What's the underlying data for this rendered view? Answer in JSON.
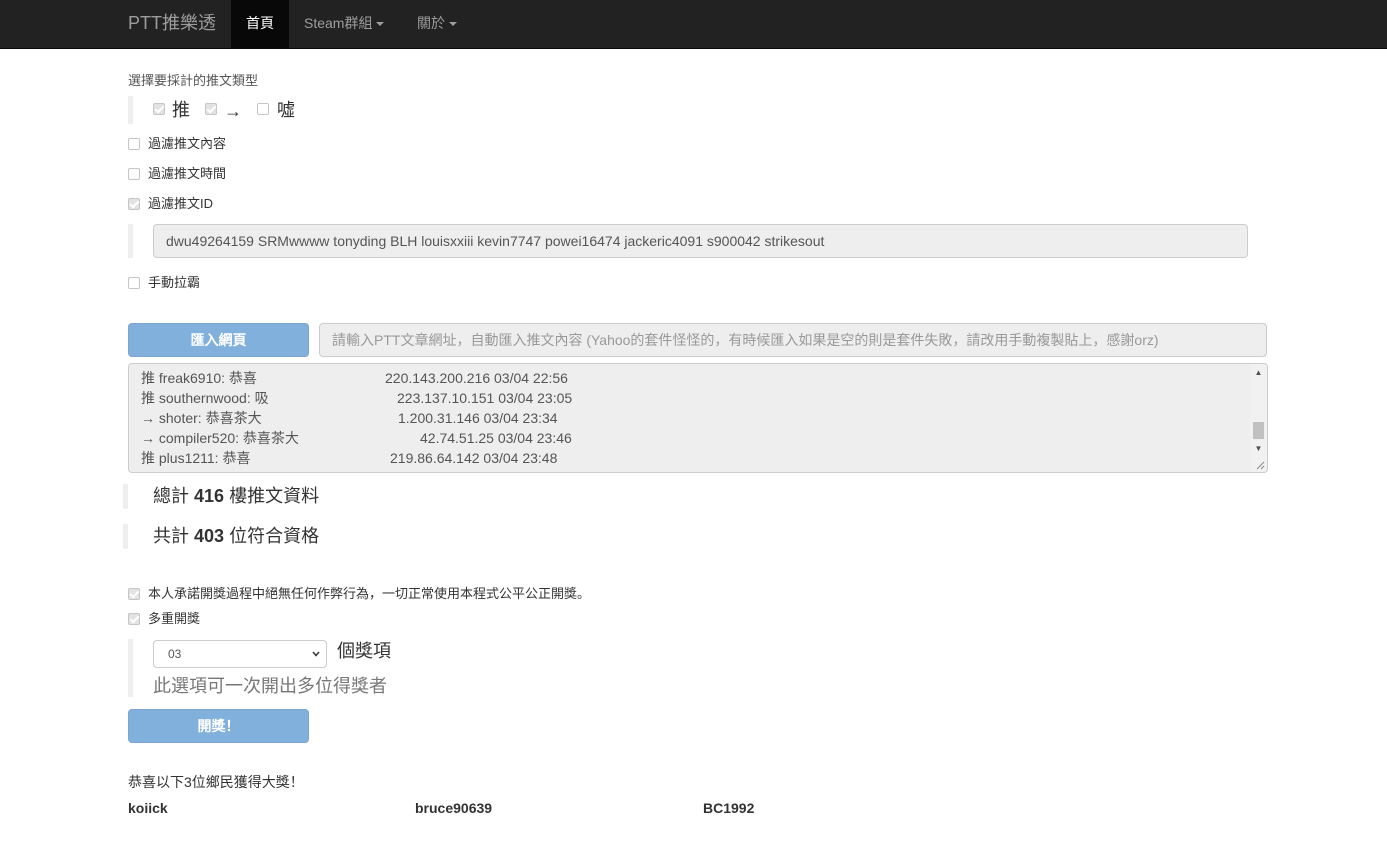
{
  "navbar": {
    "brand": "PTT推樂透",
    "items": [
      {
        "label": "首頁",
        "active": true
      },
      {
        "label": "Steam群組",
        "dropdown": true
      },
      {
        "label": "關於",
        "dropdown": true
      }
    ]
  },
  "push_type": {
    "heading": "選擇要採計的推文類型",
    "options": [
      {
        "label": "推",
        "checked": true
      },
      {
        "label": "→",
        "checked": true
      },
      {
        "label": "噓",
        "checked": false
      }
    ]
  },
  "filters": {
    "content": {
      "label": "過濾推文內容",
      "checked": false
    },
    "time": {
      "label": "過濾推文時間",
      "checked": false
    },
    "id": {
      "label": "過濾推文ID",
      "checked": true
    },
    "id_list": "dwu49264159 SRMwwww tonyding BLH louisxxiii kevin7747 powei16474 jackeric4091 s900042 strikesout",
    "manual": {
      "label": "手動拉霸",
      "checked": false
    }
  },
  "import": {
    "button_label": "匯入網頁",
    "url_placeholder": "請輸入PTT文章網址，自動匯入推文內容 (Yahoo的套件怪怪的，有時候匯入如果是空的則是套件失敗，請改用手動複製貼上，感謝orz)"
  },
  "push_list": [
    {
      "text": "推 freak6910: 恭喜",
      "meta": "220.143.200.216 03/04 22:56"
    },
    {
      "text": "推 southernwood: 吸",
      "meta": "223.137.10.151 03/04 23:05"
    },
    {
      "text": "→ shoter: 恭喜茶大",
      "meta": "1.200.31.146 03/04 23:34"
    },
    {
      "text": "→ compiler520: 恭喜茶大",
      "meta": "42.74.51.25 03/04 23:46"
    },
    {
      "text": "推 plus1211: 恭喜",
      "meta": "219.86.64.142 03/04 23:48"
    }
  ],
  "stats": {
    "total_prefix": "總計",
    "total_count": "416",
    "total_suffix": "樓推文資料",
    "eligible_prefix": "共計",
    "eligible_count": "403",
    "eligible_suffix": "位符合資格"
  },
  "draw": {
    "pledge": {
      "label": "本人承諾開獎過程中絕無任何作弊行為，一切正常使用本程式公平公正開獎。",
      "checked": true
    },
    "multi": {
      "label": "多重開獎",
      "checked": true
    },
    "prize_count": "03",
    "prize_suffix": "個獎項",
    "hint": "此選項可一次開出多位得獎者",
    "button_label": "開獎！"
  },
  "result": {
    "heading": "恭喜以下3位鄉民獲得大獎！",
    "winners": [
      "koiick",
      "bruce90639",
      "BC1992"
    ]
  }
}
